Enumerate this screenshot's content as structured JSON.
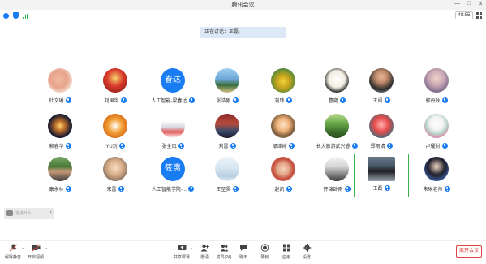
{
  "window": {
    "title": "腾讯会议",
    "controls": [
      "—",
      "□",
      "✕"
    ]
  },
  "status": {
    "timer": "48:55"
  },
  "speaking": "正在讲话：王磊;",
  "participants": [
    {
      "name": "杜文琳",
      "avatar": "ear-photo"
    },
    {
      "name": "刘国华",
      "avatar": "logo-photo"
    },
    {
      "name": "人工智能-梁春达",
      "avatar": "text",
      "avatar_text": "春达"
    },
    {
      "name": "张浩刚",
      "avatar": "landscape-photo"
    },
    {
      "name": "刘玮",
      "avatar": "duck-photo"
    },
    {
      "name": "曹崴",
      "avatar": "sketch-photo"
    },
    {
      "name": "王闯",
      "avatar": "portrait-photo"
    },
    {
      "name": "郭丹秋",
      "avatar": "girl-photo"
    },
    {
      "name": "赖春华",
      "avatar": "fireworks-photo"
    },
    {
      "name": "YU刘",
      "avatar": "tiger-photo"
    },
    {
      "name": "张全风",
      "avatar": "figure-photo"
    },
    {
      "name": "刘雷",
      "avatar": "stage-photo"
    },
    {
      "name": "邹津婷",
      "avatar": "cartoon-photo"
    },
    {
      "name": "长大旅游武兴睿",
      "avatar": "nature-photo"
    },
    {
      "name": "郑雨婧",
      "avatar": "red-photo"
    },
    {
      "name": "卢耀財",
      "avatar": "flower-photo"
    },
    {
      "name": "康永林",
      "avatar": "person-photo"
    },
    {
      "name": "宋雷",
      "avatar": "baby-photo"
    },
    {
      "name": "人工智能学院-...",
      "avatar": "text",
      "avatar_text": "筱惠"
    },
    {
      "name": "王圣昊",
      "avatar": "sky-photo"
    },
    {
      "name": "赵凯",
      "avatar": "hand-photo"
    },
    {
      "name": "怀锦卧雨",
      "avatar": "screen-photo"
    },
    {
      "name": "王磊",
      "avatar": "car-photo",
      "active": true
    },
    {
      "name": "朱琳老师",
      "avatar": "woman-photo"
    }
  ],
  "chat": {
    "placeholder": "说点什么..."
  },
  "toolbar": {
    "left": [
      {
        "label": "解除静音",
        "icon": "mic-muted-icon"
      },
      {
        "label": "开启视频",
        "icon": "video-off-icon"
      }
    ],
    "center": [
      {
        "label": "共享屏幕",
        "icon": "share-screen-icon"
      },
      {
        "label": "邀请",
        "icon": "invite-icon"
      },
      {
        "label": "成员(24)",
        "icon": "members-icon"
      },
      {
        "label": "聊天",
        "icon": "chat-icon"
      },
      {
        "label": "录制",
        "icon": "record-icon"
      },
      {
        "label": "应用",
        "icon": "apps-icon"
      },
      {
        "label": "设置",
        "icon": "settings-icon"
      }
    ],
    "leave": "离开会议"
  },
  "colors": {
    "accent": "#1a7cf2",
    "active_border": "#38b449",
    "leave": "#e0443e"
  }
}
